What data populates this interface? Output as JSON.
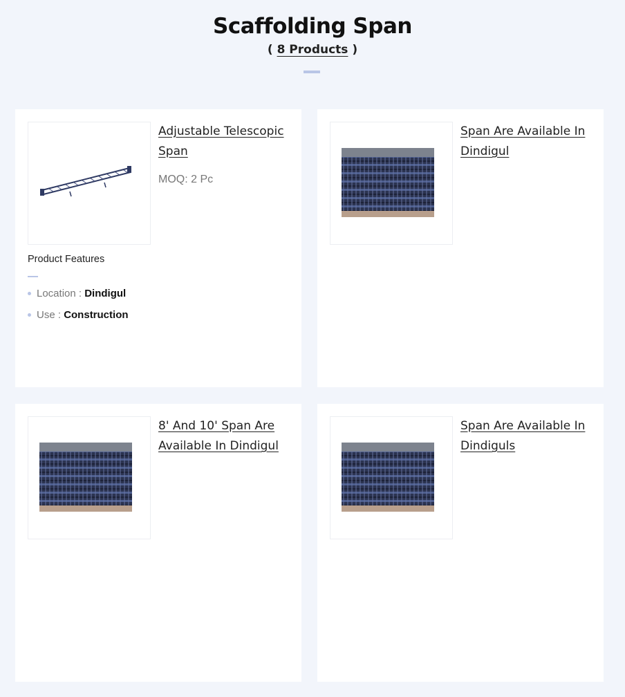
{
  "page": {
    "title": "Scaffolding Span",
    "count_prefix": "( ",
    "count_text": "8 Products",
    "count_suffix": " )"
  },
  "products": [
    {
      "title": "Adjustable Telescopic Span",
      "moq": "MOQ: 2 Pc",
      "features_label": "Product Features",
      "features": [
        {
          "label": "Location :",
          "value": "Dindigul"
        },
        {
          "label": "Use :",
          "value": "Construction"
        }
      ]
    },
    {
      "title": "Span Are Available In Dindigul"
    },
    {
      "title": "8' And 10' Span Are Available In Dindigul"
    },
    {
      "title": "Span Are Available In Dindiguls"
    }
  ],
  "colors": {
    "background": "#f2f5fb",
    "accent": "#b9c5e6",
    "card": "#ffffff"
  }
}
